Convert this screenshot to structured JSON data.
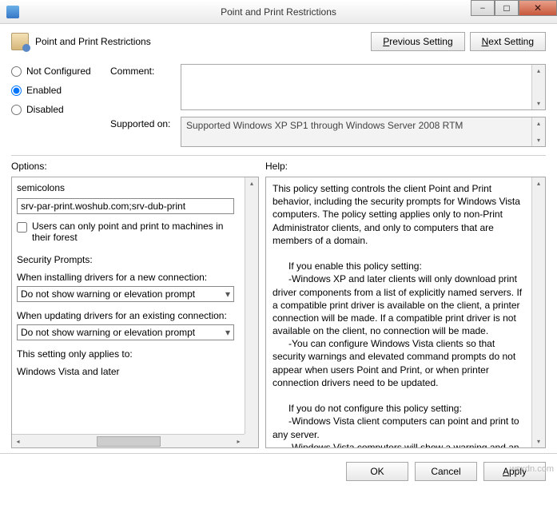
{
  "window": {
    "title": "Point and Print Restrictions",
    "min": "−",
    "max": "□",
    "close": "✕"
  },
  "header": {
    "title": "Point and Print Restrictions",
    "prev_p": "P",
    "prev_rest": "revious Setting",
    "next_n": "N",
    "next_rest": "ext Setting"
  },
  "radios": {
    "not_configured": "Not Configured",
    "not_configured_u": "C",
    "enabled": "Enabled",
    "enabled_u": "E",
    "disabled": "Disabled",
    "disabled_u": "D"
  },
  "fields": {
    "comment_label": "Comment:",
    "supported_label": "Supported on:",
    "supported_value": "Supported Windows XP SP1 through Windows Server 2008 RTM"
  },
  "options": {
    "label": "Options:",
    "semicolons_label": "semicolons",
    "server_list": "srv-par-print.woshub.com;srv-dub-print",
    "forest_checkbox": "Users can only point and print to machines in their forest",
    "security_prompts": "Security Prompts:",
    "install_label": "When installing drivers for a new connection:",
    "install_value": "Do not show warning or elevation prompt",
    "update_label": "When updating drivers for an existing connection:",
    "update_value": "Do not show warning or elevation prompt",
    "applies_label": "This setting only applies to:",
    "applies_value": "Windows Vista and later"
  },
  "help": {
    "label": "Help:",
    "text": "This policy setting controls the client Point and Print behavior, including the security prompts for Windows Vista computers. The policy setting applies only to non-Print Administrator clients, and only to computers that are members of a domain.\n\n      If you enable this policy setting:\n      -Windows XP and later clients will only download print driver components from a list of explicitly named servers. If a compatible print driver is available on the client, a printer connection will be made. If a compatible print driver is not available on the client, no connection will be made.\n      -You can configure Windows Vista clients so that security warnings and elevated command prompts do not appear when users Point and Print, or when printer connection drivers need to be updated.\n\n      If you do not configure this policy setting:\n      -Windows Vista client computers can point and print to any server.\n      -Windows Vista computers will show a warning and an elevated command prompt when users create a printer"
  },
  "footer": {
    "ok": "OK",
    "cancel": "Cancel",
    "apply_a": "A",
    "apply_rest": "pply"
  },
  "watermark": "wsxdn.com"
}
